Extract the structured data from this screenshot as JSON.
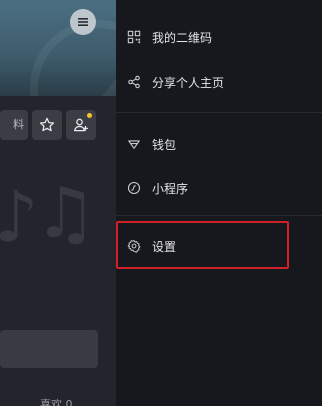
{
  "left_panel": {
    "profile_button_label": "料",
    "likes_label": "喜欢 0",
    "menu_icon": "hamburger-menu-icon",
    "star_icon": "star-outline-icon",
    "add_friend_icon": "add-user-icon",
    "colors": {
      "cover_top": "#4b6f82",
      "panel_bg": "#23242c",
      "notify_dot": "#f7c331"
    }
  },
  "drawer": {
    "items": [
      {
        "label": "我的二维码",
        "icon": "qr-code-icon"
      },
      {
        "label": "分享个人主页",
        "icon": "share-icon"
      },
      {
        "label": "钱包",
        "icon": "wallet-icon"
      },
      {
        "label": "小程序",
        "icon": "mini-program-icon"
      },
      {
        "label": "设置",
        "icon": "settings-gear-icon"
      }
    ],
    "colors": {
      "background": "#17181e",
      "text": "#e4e5e8",
      "highlight": "#d0202a"
    }
  }
}
